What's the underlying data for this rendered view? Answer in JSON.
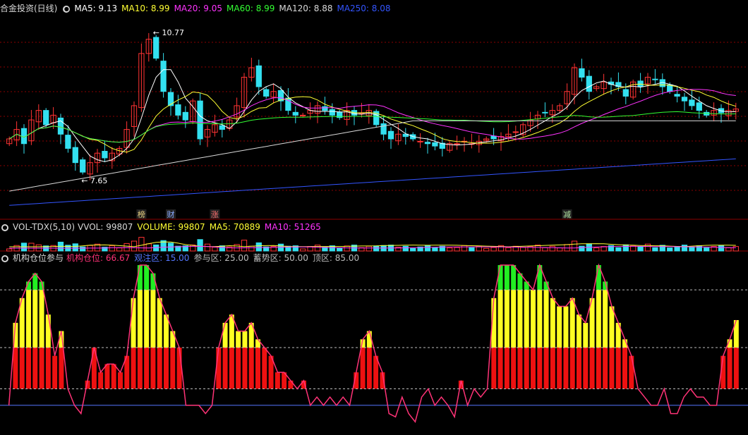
{
  "main": {
    "title": "合金投资(日线)",
    "ma_labels": [
      {
        "text": "MA5: 9.13",
        "color": "#ffffff"
      },
      {
        "text": "MA10: 8.99",
        "color": "#ffff33"
      },
      {
        "text": "MA20: 9.05",
        "color": "#ff33ff"
      },
      {
        "text": "MA60: 8.99",
        "color": "#33ff33"
      },
      {
        "text": "MA120: 8.88",
        "color": "#d8d8d8"
      },
      {
        "text": "MA250: 8.08",
        "color": "#3355ff"
      }
    ],
    "high_label": "10.77",
    "low_label": "7.65",
    "event_tags": [
      {
        "text": "榜",
        "color": "#e8d080"
      },
      {
        "text": "财",
        "color": "#88aaff"
      },
      {
        "text": "涨",
        "color": "#ff7070"
      },
      {
        "text": "减",
        "color": "#b0e0a0"
      }
    ]
  },
  "volume": {
    "title": "VOL-TDX(5,10)",
    "labels": [
      {
        "text": "VVOL: 99807",
        "color": "#d8d8d8"
      },
      {
        "text": "VOLUME: 99807",
        "color": "#ffff33"
      },
      {
        "text": "MA5: 70889",
        "color": "#ffff33"
      },
      {
        "text": "MA10: 51265",
        "color": "#ff33ff"
      }
    ]
  },
  "indicator": {
    "title": "机构仓位参与",
    "labels": [
      {
        "text": "机构仓位: 66.67",
        "color": "#ff3377"
      },
      {
        "text": "观注区: 15.00",
        "color": "#5577ff"
      },
      {
        "text": "参与区: 25.00",
        "color": "#bbbbbb"
      },
      {
        "text": "蓄势区: 50.00",
        "color": "#bbbbbb"
      },
      {
        "text": "顶区: 85.00",
        "color": "#bbbbbb"
      }
    ]
  },
  "colors": {
    "up": "#ff3333",
    "down": "#33e0f0",
    "grid": "#8b0000"
  },
  "chart_data": [
    {
      "type": "candlestick",
      "ylim": [
        7.0,
        11.1
      ],
      "close": [
        8.5,
        8.7,
        8.4,
        8.9,
        9.1,
        8.8,
        9.0,
        8.6,
        8.3,
        8.0,
        7.8,
        8.0,
        8.2,
        8.1,
        8.2,
        8.3,
        8.7,
        9.2,
        10.3,
        10.6,
        10.2,
        9.5,
        9.2,
        9.0,
        8.9,
        9.3,
        8.5,
        8.7,
        8.8,
        8.7,
        8.9,
        9.2,
        9.8,
        10.0,
        9.6,
        9.4,
        9.5,
        9.3,
        9.1,
        9.0,
        9.0,
        9.1,
        9.2,
        9.1,
        9.0,
        8.95,
        9.1,
        9.0,
        9.05,
        9.1,
        8.8,
        8.6,
        8.5,
        8.6,
        8.55,
        8.5,
        8.45,
        8.4,
        8.35,
        8.3,
        8.4,
        8.4,
        8.45,
        8.4,
        8.45,
        8.5,
        8.5,
        8.55,
        8.6,
        8.65,
        8.8,
        8.9,
        9.0,
        9.05,
        9.1,
        9.2,
        9.5,
        10.0,
        9.8,
        9.5,
        9.6,
        9.7,
        9.65,
        9.6,
        9.4,
        9.7,
        9.6,
        9.8,
        9.75,
        9.6,
        9.5,
        9.4,
        9.3,
        9.2,
        9.1,
        9.0,
        9.1,
        9.05,
        9.1,
        9.13
      ],
      "ma5_last": 9.13,
      "ma10_last": 8.99,
      "ma20_last": 9.05,
      "ma60_last": 8.99,
      "ma120_last": 8.88,
      "ma250_last": 8.08,
      "high": 10.77,
      "low": 7.65
    },
    {
      "type": "bar",
      "series": [
        {
          "name": "VOLUME",
          "last": 99807
        },
        {
          "name": "MA5",
          "last": 70889
        },
        {
          "name": "MA10",
          "last": 51265
        }
      ]
    },
    {
      "type": "bar",
      "ylim": [
        0,
        100
      ],
      "levels": [
        15,
        25,
        50,
        85
      ],
      "values": [
        15,
        65,
        80,
        90,
        95,
        90,
        70,
        45,
        60,
        25,
        15,
        10,
        30,
        50,
        35,
        40,
        40,
        35,
        45,
        80,
        100,
        100,
        95,
        80,
        70,
        60,
        50,
        15,
        15,
        15,
        10,
        15,
        50,
        65,
        70,
        60,
        60,
        65,
        55,
        50,
        45,
        35,
        35,
        30,
        25,
        30,
        15,
        20,
        15,
        20,
        15,
        20,
        15,
        35,
        55,
        60,
        45,
        35,
        10,
        8,
        20,
        10,
        5,
        20,
        25,
        15,
        20,
        15,
        8,
        30,
        15,
        25,
        20,
        25,
        80,
        100,
        100,
        100,
        95,
        90,
        85,
        100,
        90,
        80,
        75,
        75,
        80,
        70,
        65,
        80,
        100,
        90,
        75,
        65,
        55,
        45,
        25,
        20,
        15,
        15,
        25,
        10,
        10,
        20,
        25,
        20,
        20,
        15,
        15,
        45,
        55,
        66.67
      ],
      "current": 66.67
    }
  ]
}
